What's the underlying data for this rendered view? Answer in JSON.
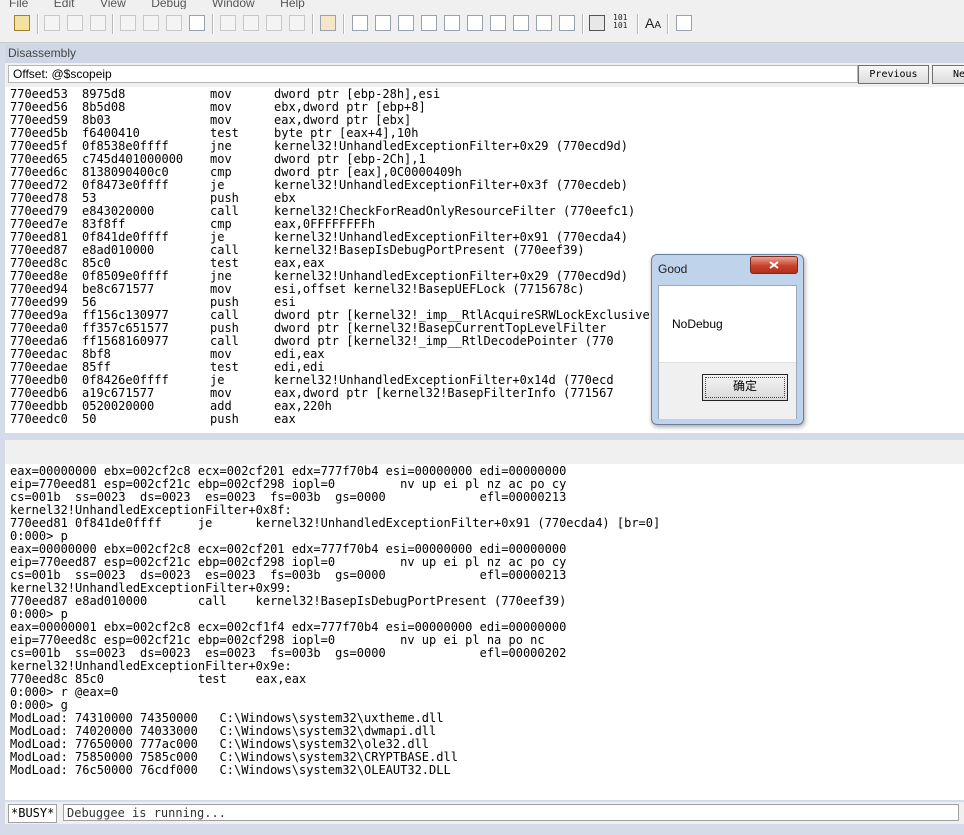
{
  "menu": [
    "File",
    "Edit",
    "View",
    "Debug",
    "Window",
    "Help"
  ],
  "toolbar": {
    "text_buttons": [
      "101\n101",
      "AA"
    ]
  },
  "disassembly": {
    "title": "Disassembly",
    "offset_label": "Offset:",
    "offset_value": "@$scopeip",
    "previous_label": "Previous",
    "next_label": "Next",
    "lines": [
      [
        "770eed53",
        "8975d8",
        "mov",
        "dword ptr [ebp-28h],esi"
      ],
      [
        "770eed56",
        "8b5d08",
        "mov",
        "ebx,dword ptr [ebp+8]"
      ],
      [
        "770eed59",
        "8b03",
        "mov",
        "eax,dword ptr [ebx]"
      ],
      [
        "770eed5b",
        "f6400410",
        "test",
        "byte ptr [eax+4],10h"
      ],
      [
        "770eed5f",
        "0f8538e0ffff",
        "jne",
        "kernel32!UnhandledExceptionFilter+0x29 (770ecd9d)"
      ],
      [
        "770eed65",
        "c745d401000000",
        "mov",
        "dword ptr [ebp-2Ch],1"
      ],
      [
        "770eed6c",
        "8138090400c0",
        "cmp",
        "dword ptr [eax],0C0000409h"
      ],
      [
        "770eed72",
        "0f8473e0ffff",
        "je",
        "kernel32!UnhandledExceptionFilter+0x3f (770ecdeb)"
      ],
      [
        "770eed78",
        "53",
        "push",
        "ebx"
      ],
      [
        "770eed79",
        "e843020000",
        "call",
        "kernel32!CheckForReadOnlyResourceFilter (770eefc1)"
      ],
      [
        "770eed7e",
        "83f8ff",
        "cmp",
        "eax,0FFFFFFFFh"
      ],
      [
        "770eed81",
        "0f841de0ffff",
        "je",
        "kernel32!UnhandledExceptionFilter+0x91 (770ecda4)"
      ],
      [
        "770eed87",
        "e8ad010000",
        "call",
        "kernel32!BasepIsDebugPortPresent (770eef39)"
      ],
      [
        "770eed8c",
        "85c0",
        "test",
        "eax,eax"
      ],
      [
        "770eed8e",
        "0f8509e0ffff",
        "jne",
        "kernel32!UnhandledExceptionFilter+0x29 (770ecd9d)"
      ],
      [
        "770eed94",
        "be8c671577",
        "mov",
        "esi,offset kernel32!BasepUEFLock (7715678c)"
      ],
      [
        "770eed99",
        "56",
        "push",
        "esi"
      ],
      [
        "770eed9a",
        "ff156c130977",
        "call",
        "dword ptr [kernel32!_imp__RtlAcquireSRWLockExclusive]"
      ],
      [
        "770eeda0",
        "ff357c651577",
        "push",
        "dword ptr [kernel32!BasepCurrentTopLevelFilter"
      ],
      [
        "770eeda6",
        "ff1568160977",
        "call",
        "dword ptr [kernel32!_imp__RtlDecodePointer (770"
      ],
      [
        "770eedac",
        "8bf8",
        "mov",
        "edi,eax"
      ],
      [
        "770eedae",
        "85ff",
        "test",
        "edi,edi"
      ],
      [
        "770eedb0",
        "0f8426e0ffff",
        "je",
        "kernel32!UnhandledExceptionFilter+0x14d (770ecd"
      ],
      [
        "770eedb6",
        "a19c671577",
        "mov",
        "eax,dword ptr [kernel32!BasepFilterInfo (771567"
      ],
      [
        "770eedbb",
        "0520020000",
        "add",
        "eax,220h"
      ],
      [
        "770eedc0",
        "50",
        "push",
        "eax"
      ]
    ]
  },
  "command": {
    "lines": [
      "eax=00000000 ebx=002cf2c8 ecx=002cf201 edx=777f70b4 esi=00000000 edi=00000000",
      "eip=770eed81 esp=002cf21c ebp=002cf298 iopl=0         nv up ei pl nz ac po cy",
      "cs=001b  ss=0023  ds=0023  es=0023  fs=003b  gs=0000             efl=00000213",
      "kernel32!UnhandledExceptionFilter+0x8f:",
      "770eed81 0f841de0ffff     je      kernel32!UnhandledExceptionFilter+0x91 (770ecda4) [br=0]",
      "0:000> p",
      "eax=00000000 ebx=002cf2c8 ecx=002cf201 edx=777f70b4 esi=00000000 edi=00000000",
      "eip=770eed87 esp=002cf21c ebp=002cf298 iopl=0         nv up ei pl nz ac po cy",
      "cs=001b  ss=0023  ds=0023  es=0023  fs=003b  gs=0000             efl=00000213",
      "kernel32!UnhandledExceptionFilter+0x99:",
      "770eed87 e8ad010000       call    kernel32!BasepIsDebugPortPresent (770eef39)",
      "0:000> p",
      "eax=00000001 ebx=002cf2c8 ecx=002cf1f4 edx=777f70b4 esi=00000000 edi=00000000",
      "eip=770eed8c esp=002cf21c ebp=002cf298 iopl=0         nv up ei pl na po nc",
      "cs=001b  ss=0023  ds=0023  es=0023  fs=003b  gs=0000             efl=00000202",
      "kernel32!UnhandledExceptionFilter+0x9e:",
      "770eed8c 85c0             test    eax,eax",
      "0:000> r @eax=0",
      "0:000> g",
      "ModLoad: 74310000 74350000   C:\\Windows\\system32\\uxtheme.dll",
      "ModLoad: 74020000 74033000   C:\\Windows\\system32\\dwmapi.dll",
      "ModLoad: 77650000 777ac000   C:\\Windows\\system32\\ole32.dll",
      "ModLoad: 75850000 7585c000   C:\\Windows\\system32\\CRYPTBASE.dll",
      "ModLoad: 76c50000 76cdf000   C:\\Windows\\system32\\OLEAUT32.DLL"
    ]
  },
  "status": {
    "busy": "*BUSY*",
    "message": "Debuggee is running..."
  },
  "dialog": {
    "title": "Good",
    "message": "NoDebug",
    "ok_label": "确定"
  }
}
